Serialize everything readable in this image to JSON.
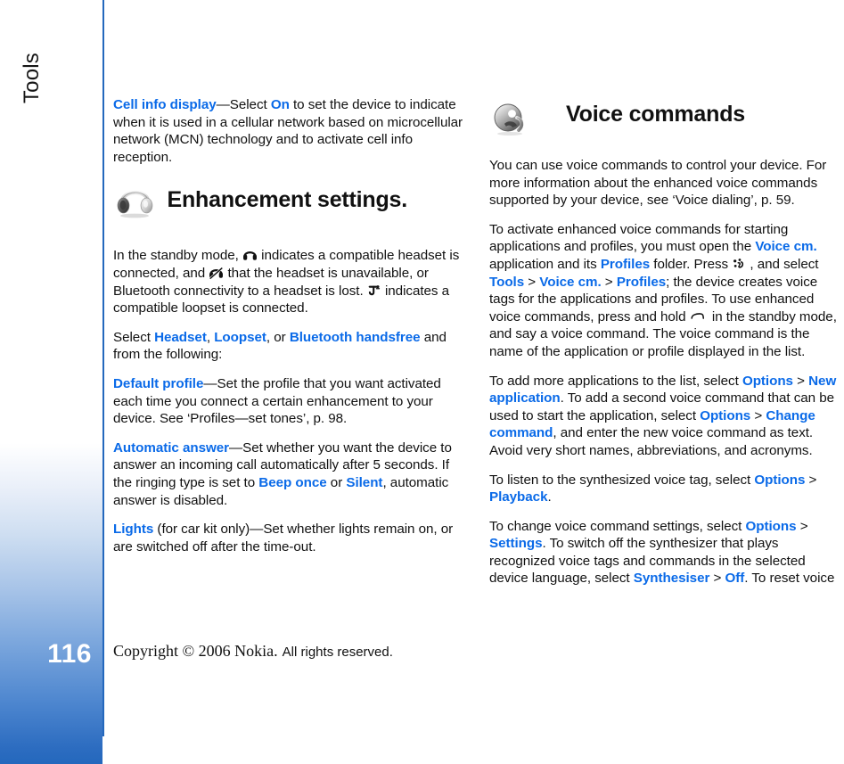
{
  "sidebar": {
    "chapter": "Tools",
    "page_number": "116",
    "accent_color": "#2468bd"
  },
  "footer": {
    "copyright_serif": "Copyright © 2006 Nokia.",
    "copyright_sans": "All rights reserved."
  },
  "link_color": "#0a6ae8",
  "left_column": {
    "p_cell_info": {
      "t1": "—Select ",
      "l1": "Cell info display",
      "l2": "On",
      "t2": " to set the device to indicate when it is used in a cellular network based on microcellular network (MCN) technology and to activate cell info reception."
    },
    "heading_enhancement": "Enhancement settings.",
    "p_standby": {
      "t1": "In the standby mode, ",
      "t2": " indicates a compatible headset is connected, and ",
      "t3": " that the headset is unavailable, or Bluetooth connectivity to a headset is lost. ",
      "t4": " indicates a compatible loopset is connected."
    },
    "p_select": {
      "t1": "Select ",
      "l1": "Headset",
      "t2": ", ",
      "l2": "Loopset",
      "t3": ", or ",
      "l3": "Bluetooth handsfree",
      "t4": " and from the following:"
    },
    "p_default_profile": {
      "l1": "Default profile",
      "t1": "—Set the profile that you want activated each time you connect a certain enhancement to your device. See ‘Profiles—set tones’, p. 98."
    },
    "p_automatic_answer": {
      "l1": "Automatic answer",
      "t1": "—Set whether you want the device to answer an incoming call automatically after 5 seconds. If the ringing type is set to ",
      "l2": "Beep once",
      "t2": " or ",
      "l3": "Silent",
      "t3": ", automatic answer is disabled."
    },
    "p_lights": {
      "l1": "Lights",
      "t1": " (for car kit only)—Set whether lights remain on, or are switched off after the time-out."
    }
  },
  "right_column": {
    "heading_voice": "Voice commands",
    "p_intro": "You can use voice commands to control your device. For more information about the enhanced voice commands supported by your device, see ‘Voice dialing’, p. 59.",
    "p_activate": {
      "t1": "To activate enhanced voice commands for starting applications and profiles, you must open the ",
      "l1": "Voice cm.",
      "t2": " application and its ",
      "l2": "Profiles",
      "t3": " folder. Press ",
      "t4": " , and select ",
      "l3": "Tools",
      "g1": " > ",
      "l4": "Voice cm.",
      "g2": " > ",
      "l5": "Profiles",
      "t5": "; the device creates voice tags for the applications and profiles. To use enhanced voice commands, press and hold ",
      "t6": " in the standby mode, and say a voice command. The voice command is the name of the application or profile displayed in the list."
    },
    "p_add": {
      "t1": "To add more applications to the list, select ",
      "l1": "Options",
      "g1": " > ",
      "l2": "New application",
      "t2": ". To add a second voice command that can be used to start the application, select ",
      "l3": "Options",
      "g2": " > ",
      "l4": "Change command",
      "t3": ", and enter the new voice command as text. Avoid very short names, abbreviations, and acronyms."
    },
    "p_listen": {
      "t1": "To listen to the synthesized voice tag, select ",
      "l1": "Options",
      "g1": " > ",
      "l2": "Playback",
      "t2": "."
    },
    "p_change": {
      "t1": "To change voice command settings, select ",
      "l1": "Options",
      "g1": " > ",
      "l2": "Settings",
      "t2": ". To switch off the synthesizer that plays recognized voice tags and commands in the selected device language, select ",
      "l3": "Synthesiser",
      "g2": " > ",
      "l4": "Off",
      "t3": ". To reset voice"
    }
  }
}
